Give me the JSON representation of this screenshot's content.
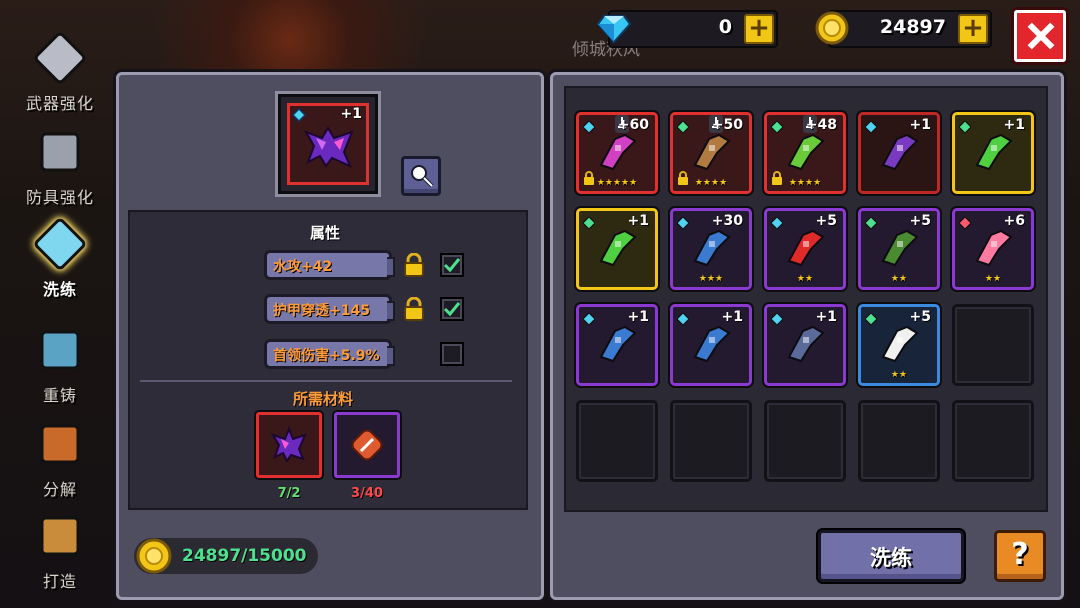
{
  "player_name": "倾城秋风",
  "currencies": {
    "gems": {
      "value": "0",
      "icon": "diamond-icon"
    },
    "gold": {
      "value": "24897",
      "icon": "gold-coin-icon"
    }
  },
  "sidebar": [
    {
      "label": "武器强化",
      "icon": "sword-upgrade-icon",
      "active": false
    },
    {
      "label": "防具强化",
      "icon": "armor-upgrade-icon",
      "active": false
    },
    {
      "label": "洗练",
      "icon": "reforge-blade-icon",
      "active": true
    },
    {
      "label": "重铸",
      "icon": "recast-armor-icon",
      "active": false
    },
    {
      "label": "分解",
      "icon": "cauldron-icon",
      "active": false
    },
    {
      "label": "打造",
      "icon": "forge-icon",
      "active": false
    }
  ],
  "selected_item": {
    "level": "+1",
    "icon": "purple-claw-weapon-icon",
    "rarity_color": "#e03030"
  },
  "attributes": {
    "title": "属性",
    "rows": [
      {
        "label": "水攻+42",
        "locked": true,
        "checked": true
      },
      {
        "label": "护甲穿透+145",
        "locked": true,
        "checked": true
      },
      {
        "label": "首领伤害+5.9%",
        "locked": false,
        "checked": false
      }
    ]
  },
  "materials": {
    "title": "所需材料",
    "items": [
      {
        "icon": "purple-claw-weapon-icon",
        "count": "7/2",
        "count_color": "#63e06a",
        "border": "#e03030"
      },
      {
        "icon": "red-forge-stone-icon",
        "count": "3/40",
        "count_color": "#ff4a4a",
        "border": "#8a3ad0"
      }
    ]
  },
  "gold_cost": "24897/15000",
  "inventory": [
    {
      "level": "+60",
      "border": "#e03030",
      "bg": "#3a1718",
      "gem": "#4fd3f0",
      "stars": "★★★★★",
      "locked": true,
      "equipped": true,
      "icon": "magenta-staff-icon"
    },
    {
      "level": "+50",
      "border": "#e03030",
      "bg": "#3a1718",
      "gem": "#4de08e",
      "stars": "★★★★",
      "locked": true,
      "equipped": true,
      "icon": "brown-golem-icon"
    },
    {
      "level": "+48",
      "border": "#e03030",
      "bg": "#3a1718",
      "gem": "#4de08e",
      "stars": "★★★★",
      "locked": true,
      "equipped": true,
      "icon": "green-bow-icon"
    },
    {
      "level": "+1",
      "border": "#c02828",
      "bg": "#2a1414",
      "gem": "#4fd3f0",
      "stars": "",
      "locked": false,
      "equipped": false,
      "icon": "purple-claw-selected-icon"
    },
    {
      "level": "+1",
      "border": "#f2c617",
      "bg": "#2e2a12",
      "gem": "#4de08e",
      "stars": "",
      "locked": false,
      "equipped": false,
      "icon": "green-whip-icon"
    },
    {
      "level": "+1",
      "border": "#f2c617",
      "bg": "#2e2a12",
      "gem": "#4de08e",
      "stars": "",
      "locked": false,
      "equipped": false,
      "icon": "green-whip-icon"
    },
    {
      "level": "+30",
      "border": "#8a3ad0",
      "bg": "#241a30",
      "gem": "#4fd3f0",
      "stars": "★★★",
      "locked": false,
      "equipped": false,
      "icon": "blue-rifle-icon"
    },
    {
      "level": "+5",
      "border": "#8a3ad0",
      "bg": "#241a30",
      "gem": "#4fd3f0",
      "stars": "★★",
      "locked": false,
      "equipped": false,
      "icon": "fire-extinguisher-icon"
    },
    {
      "level": "+5",
      "border": "#8a3ad0",
      "bg": "#241a30",
      "gem": "#4de08e",
      "stars": "★★",
      "locked": false,
      "equipped": false,
      "icon": "green-launcher-icon"
    },
    {
      "level": "+6",
      "border": "#8a3ad0",
      "bg": "#241a30",
      "gem": "#ff5a6a",
      "stars": "★★",
      "locked": false,
      "equipped": false,
      "icon": "pink-flame-icon"
    },
    {
      "level": "+1",
      "border": "#8a3ad0",
      "bg": "#241a30",
      "gem": "#4fd3f0",
      "stars": "",
      "locked": false,
      "equipped": false,
      "icon": "blue-rifle-icon"
    },
    {
      "level": "+1",
      "border": "#8a3ad0",
      "bg": "#241a30",
      "gem": "#4fd3f0",
      "stars": "",
      "locked": false,
      "equipped": false,
      "icon": "blue-rifle-icon"
    },
    {
      "level": "+1",
      "border": "#8a3ad0",
      "bg": "#241a30",
      "gem": "#4fd3f0",
      "stars": "",
      "locked": false,
      "equipped": false,
      "icon": "shield-armor-icon"
    },
    {
      "level": "+5",
      "border": "#3a8ae0",
      "bg": "#17243a",
      "gem": "#4de08e",
      "stars": "★★",
      "locked": false,
      "equipped": false,
      "icon": "white-blob-pet-icon"
    }
  ],
  "buttons": {
    "refine": "洗练",
    "help": "?"
  }
}
